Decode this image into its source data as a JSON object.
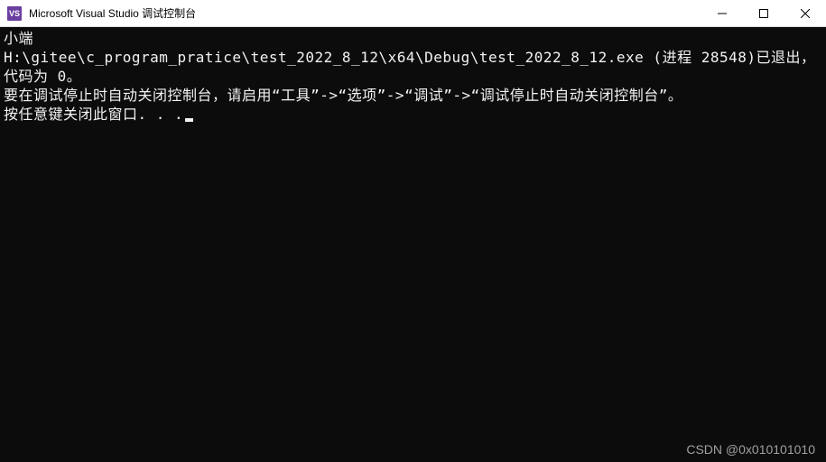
{
  "window": {
    "icon_label": "VS",
    "title": "Microsoft Visual Studio 调试控制台"
  },
  "console": {
    "line1": "小端",
    "line2": "H:\\gitee\\c_program_pratice\\test_2022_8_12\\x64\\Debug\\test_2022_8_12.exe (进程 28548)已退出，代码为 0。",
    "line3": "要在调试停止时自动关闭控制台，请启用“工具”->“选项”->“调试”->“调试停止时自动关闭控制台”。",
    "line4": "按任意键关闭此窗口. . ."
  },
  "watermark": "CSDN @0x010101010"
}
